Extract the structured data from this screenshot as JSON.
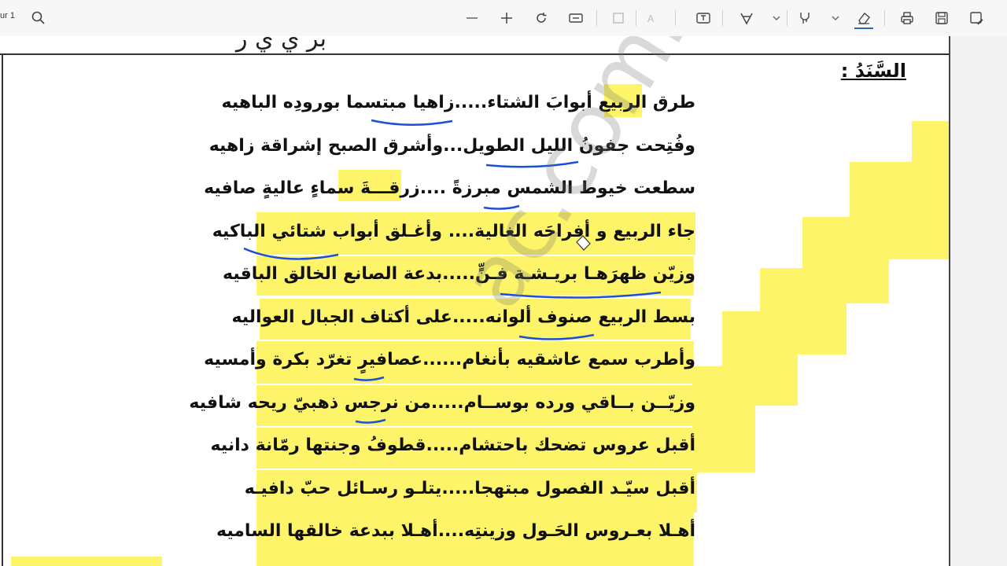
{
  "toolbar": {
    "page_indicator": "ur 1",
    "icons": [
      "search-icon",
      "zoom-out-icon",
      "zoom-in-icon",
      "rotate-icon",
      "fit-page-icon",
      "page-view-icon",
      "read-aloud-icon",
      "text-box-icon",
      "draw-icon",
      "chevron-down-icon",
      "highlight-icon",
      "chevron-down-icon",
      "eraser-icon",
      "print-icon",
      "save-icon",
      "save-as-icon"
    ]
  },
  "document": {
    "heading": "السَّنَدُ :",
    "cut_title": "بر  ي   ي          ر",
    "poem": [
      "طرق الربيع أبوابَ الشتاء.....زاهيا مبتسما بورودِه الباهيه",
      "وفُتِحت جفونُ الليل الطويل...وأشرق الصبح إشراقة زاهيه",
      "سطعت خيوط الشمس مبرزةً ....زرقـــةَ سماءٍ عاليةٍ صافيه",
      "جاء الربيع و أفراحَه الغالية.... وأغـلق أبواب شتائي الباكيه",
      "وزيّن ظهرَهـا بريـشـة فـنٍّ.....بدعة الصانع الخالق الباقيه",
      "بسط الربيع صنوف ألوانه.....على أكتاف الجبال العواليه",
      "وأطرب سمع عاشقيه بأنغام......عصافيرٍ تغرّد بكرة وأمسيه",
      "وزيّــن بــاقي ورده بوســام.....من نرجس ذهبيّ ريحه شافيه",
      "أقبل عروس تضحك باحتشام.....قطوفُ وجنتها رمّانة دانيه",
      "أقبل سيّـد الفصول مبتهجا.....يتلـو رسـائل حبّ دافيـه",
      "أهـلا بعـروس الحَـول وزينتِه....أهـلا ببدعة خالقها الساميه"
    ],
    "watermark": "ac.comlexams",
    "colors": {
      "highlight": "#fdf469",
      "ink": "#1c4fd8"
    }
  }
}
